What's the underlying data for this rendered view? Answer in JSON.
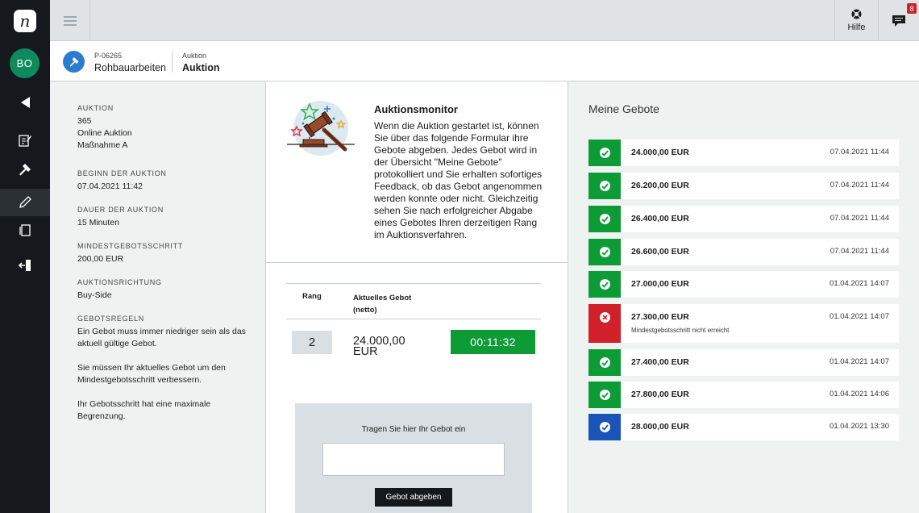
{
  "app": {
    "logo_letter": "n",
    "user_initials": "BO"
  },
  "topbar": {
    "help_label": "Hilfe",
    "notifications_count": "8"
  },
  "project": {
    "id": "P-06265",
    "name": "Rohbauarbeiten",
    "section_label": "Auktion",
    "section_name": "Auktion"
  },
  "info": {
    "auction_label": "AUKTION",
    "auction_number": "365",
    "auction_type": "Online Auktion",
    "auction_measure": "Maßnahme A",
    "start_label": "BEGINN DER AUKTION",
    "start_value": "07.04.2021 11:42",
    "duration_label": "DAUER DER AUKTION",
    "duration_value": "15 Minuten",
    "min_step_label": "MINDESTGEBOTSSCHRITT",
    "min_step_value": "200,00 EUR",
    "direction_label": "AUKTIONSRICHTUNG",
    "direction_value": "Buy-Side",
    "rules_label": "GEBOTSREGELN",
    "rule_1": "Ein Gebot muss immer niedriger sein als das aktuell gültige Gebot.",
    "rule_2": "Sie müssen Ihr aktuelles Gebot um den Mindestgebotsschritt verbessern.",
    "rule_3": "Ihr Gebotsschritt hat eine maximale Begrenzung."
  },
  "monitor": {
    "title": "Auktionsmonitor",
    "text": "Wenn die Auktion gestartet ist, können Sie über das folgende Formular ihre Gebote abgeben. Jedes Gebot wird in der Übersicht \"Meine Gebote\" protokolliert und Sie erhalten sofortiges Feedback, ob das Gebot angenommen werden konnte oder nicht. Gleichzeitig sehen Sie nach erfolgreicher Abgabe eines Gebotes Ihren derzeitigen Rang im Auktionsverfahren."
  },
  "rank": {
    "rank_header": "Rang",
    "bid_header": "Aktuelles Gebot (netto)",
    "rank_value": "2",
    "bid_value": "24.000,00 EUR",
    "timer": "00:11:32"
  },
  "bid_form": {
    "prompt": "Tragen Sie hier Ihr Gebot ein",
    "input_value": "",
    "submit_label": "Gebot abgeben"
  },
  "my_bids": {
    "title": "Meine Gebote",
    "colors": {
      "accepted": "#0c9b35",
      "rejected": "#d0202a",
      "current": "#1a54b8"
    },
    "items": [
      {
        "amount": "24.000,00 EUR",
        "date": "07.04.2021 11:44",
        "status": "accepted",
        "note": ""
      },
      {
        "amount": "26.200,00 EUR",
        "date": "07.04.2021 11:44",
        "status": "accepted",
        "note": ""
      },
      {
        "amount": "26.400,00 EUR",
        "date": "07.04.2021 11:44",
        "status": "accepted",
        "note": ""
      },
      {
        "amount": "26.600,00 EUR",
        "date": "07.04.2021 11:44",
        "status": "accepted",
        "note": ""
      },
      {
        "amount": "27.000,00 EUR",
        "date": "01.04.2021 14:07",
        "status": "accepted",
        "note": ""
      },
      {
        "amount": "27.300,00 EUR",
        "date": "01.04.2021 14:07",
        "status": "rejected",
        "note": "Mindestgebotsschritt nicht erreicht"
      },
      {
        "amount": "27.400,00 EUR",
        "date": "01.04.2021 14:07",
        "status": "accepted",
        "note": ""
      },
      {
        "amount": "27.800,00 EUR",
        "date": "01.04.2021 14:06",
        "status": "accepted",
        "note": ""
      },
      {
        "amount": "28.000,00 EUR",
        "date": "01.04.2021 13:30",
        "status": "current",
        "note": ""
      }
    ]
  }
}
